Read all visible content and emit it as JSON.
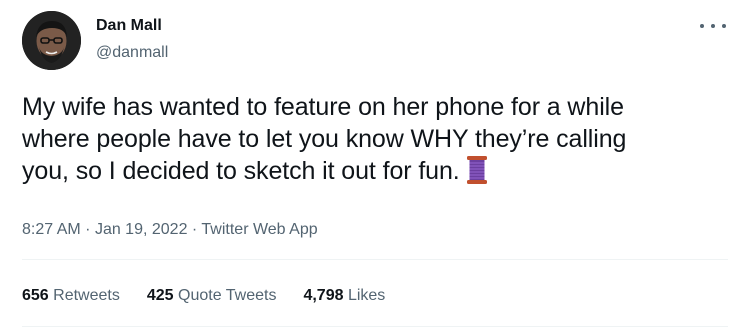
{
  "author": {
    "display_name": "Dan Mall",
    "handle": "@danmall",
    "avatar_icon": "avatar-photo"
  },
  "tweet": {
    "text_line1": "My wife has wanted to feature on her phone for a while",
    "text_line2": "where people have to let you know WHY they’re calling",
    "text_line3": "you, so I decided to sketch it out for fun.",
    "emoji": "thread-spool-icon",
    "time": "8:27 AM",
    "date": "Jan 19, 2022",
    "separator": "·",
    "source": "Twitter Web App"
  },
  "stats": {
    "retweets_count": "656",
    "retweets_label": "Retweets",
    "quote_count": "425",
    "quote_label": "Quote Tweets",
    "likes_count": "4,798",
    "likes_label": "Likes"
  },
  "colors": {
    "text": "#0f1419",
    "secondary": "#536471",
    "divider": "#eff3f4",
    "spool_thread": "#6b3fa0",
    "spool_wood": "#c1502e"
  }
}
